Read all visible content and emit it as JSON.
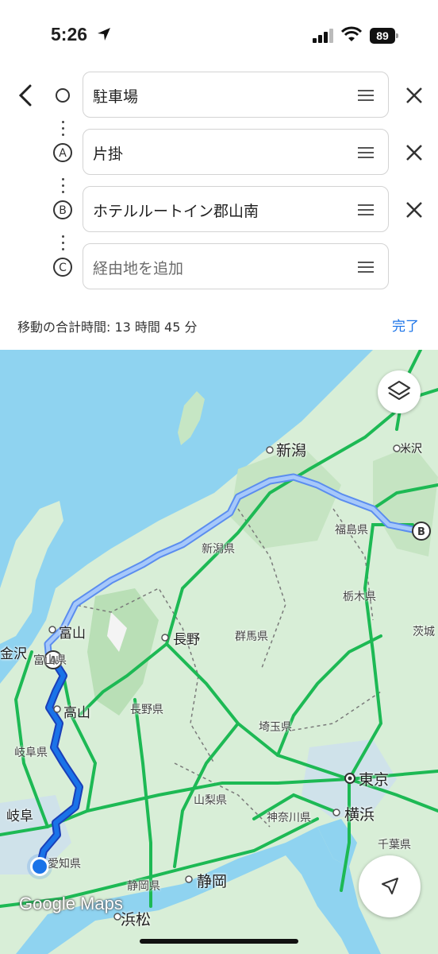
{
  "status": {
    "time": "5:26",
    "battery": "89"
  },
  "route": {
    "stops": [
      {
        "label": "駐車場",
        "placeholder": false
      },
      {
        "label": "片掛",
        "placeholder": false
      },
      {
        "label": "ホテルルートイン郡山南",
        "placeholder": false
      },
      {
        "label": "経由地を追加",
        "placeholder": true
      }
    ],
    "marker_letters": [
      "A",
      "B",
      "C"
    ],
    "summary": "移動の合計時間: 13 時間 45 分",
    "done_label": "完了"
  },
  "map": {
    "cities": {
      "niigata": "新潟",
      "toyama": "富山",
      "nagano": "長野",
      "takayama": "高山",
      "tokyo": "東京",
      "yokohama": "横浜",
      "shizuoka": "静岡",
      "hamamatsu": "浜松",
      "gifu": "岐阜",
      "kanazawa": "金沢",
      "yonezawa": "米沢"
    },
    "prefectures": {
      "niigata": "新潟県",
      "fukushima": "福島県",
      "tochigi": "栃木県",
      "ibaraki": "茨城",
      "gunma": "群馬県",
      "nagano": "長野県",
      "saitama": "埼玉県",
      "yamanashi": "山梨県",
      "kanagawa": "神奈川県",
      "chiba": "千葉県",
      "shizuoka": "静岡県",
      "aichi": "愛知県",
      "gifu": "岐阜県",
      "toyama": "富山県"
    },
    "route_markers": {
      "a": "A",
      "b": "B"
    },
    "attribution": "Google Maps",
    "colors": {
      "route": "#1a73e8",
      "alt_route": "#8ab4f8",
      "sea": "#8fd3f0",
      "land": "#d8eed7",
      "highway": "#1db954"
    }
  }
}
